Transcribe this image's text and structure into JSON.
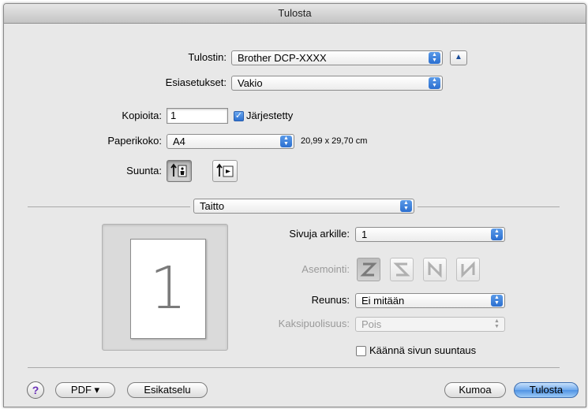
{
  "window": {
    "title": "Tulosta"
  },
  "printer": {
    "label": "Tulostin:",
    "value": "Brother DCP-XXXX",
    "expand_glyph": "▲"
  },
  "presets": {
    "label": "Esiasetukset:",
    "value": "Vakio"
  },
  "copies": {
    "label": "Kopioita:",
    "value": "1",
    "collated_label": "Järjestetty",
    "collated_checked": true
  },
  "paper": {
    "label": "Paperikoko:",
    "value": "A4",
    "dimensions": "20,99 x 29,70 cm"
  },
  "orientation": {
    "label": "Suunta:",
    "selected": "portrait"
  },
  "section_menu": {
    "value": "Taitto"
  },
  "preview": {
    "page_number": "1"
  },
  "layout": {
    "pages_per_sheet_label": "Sivuja arkille:",
    "pages_per_sheet_value": "1",
    "direction_label": "Asemointi:",
    "border_label": "Reunus:",
    "border_value": "Ei mitään",
    "two_sided_label": "Kaksipuolisuus:",
    "two_sided_value": "Pois",
    "reverse_label": "Käännä sivun suuntaus",
    "reverse_checked": false
  },
  "footer": {
    "help": "?",
    "pdf": "PDF ▾",
    "preview": "Esikatselu",
    "cancel": "Kumoa",
    "print": "Tulosta"
  },
  "colors": {
    "accent": "#4f93e4",
    "disabled_text": "#9a9a9a"
  }
}
